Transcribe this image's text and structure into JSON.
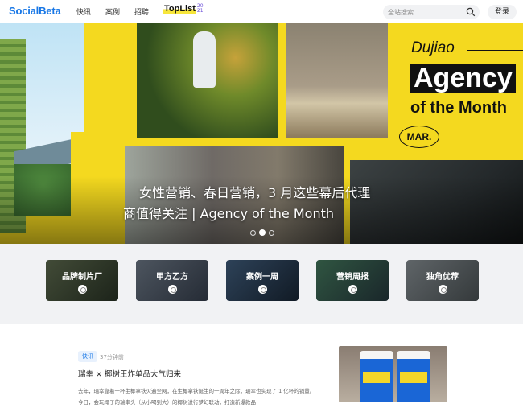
{
  "header": {
    "logo": "SocialBeta",
    "nav": [
      "快讯",
      "案例",
      "招聘"
    ],
    "toplist": {
      "main": "TopList",
      "year_top": "20",
      "year_bottom": "21"
    },
    "search_placeholder": "全站搜索",
    "login": "登录"
  },
  "banner": {
    "title_line1": "女性营销、春日营销，3 月这些幕后代理",
    "title_line2": "商值得关注 | Agency of the Month",
    "poster": {
      "brand": "Dujiao",
      "agency": "Agency",
      "month": "of the Month",
      "badge": "MAR."
    },
    "slide_count": 3,
    "active_slide": 2
  },
  "categories": [
    {
      "label": "品牌制片厂",
      "icon": "camera-icon"
    },
    {
      "label": "甲方乙方",
      "icon": "handshake-icon"
    },
    {
      "label": "案例一周",
      "icon": "calendar-icon"
    },
    {
      "label": "营销周报",
      "icon": "report-icon"
    },
    {
      "label": "独角优荐",
      "icon": "star-icon"
    }
  ],
  "article": {
    "tag": "快讯",
    "time": "37分钟前",
    "title": "瑞幸 × 椰树王炸单品大气归来",
    "desc": "去年，瑞幸靠着一杯生椰拿铁火遍全网，在生椰拿铁诞生的一周年之际，瑞幸也实现了 1 亿杯的销量。今日，会玩椰子的瑞幸头（从小喝到大）的椰树进行梦幻联动，打造新爆款品"
  },
  "colors": {
    "brand": "#1877e6",
    "accent": "#f4d91f"
  }
}
